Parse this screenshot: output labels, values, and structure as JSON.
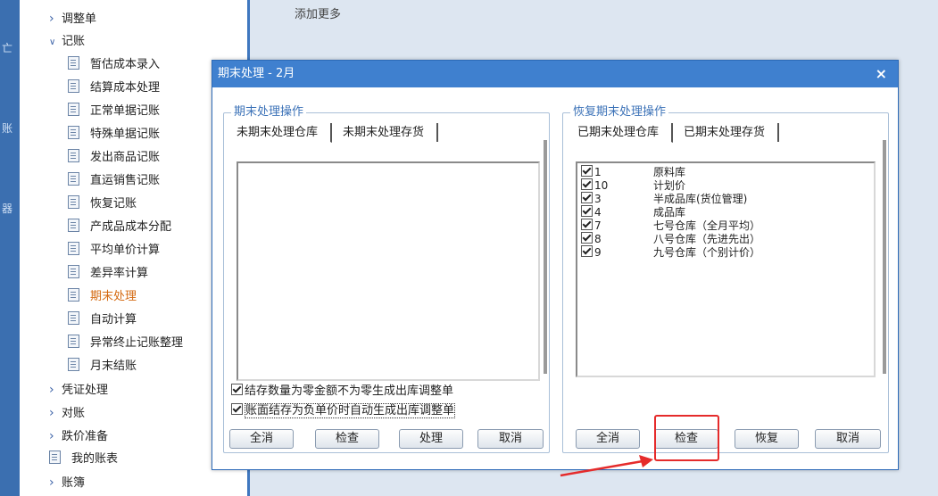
{
  "tree": {
    "partial_top": "",
    "items": [
      {
        "label": "调整单",
        "type": "folder",
        "state": "collapsed"
      },
      {
        "label": "记账",
        "type": "folder",
        "state": "expanded"
      },
      {
        "label": "暂估成本录入",
        "type": "doc"
      },
      {
        "label": "结算成本处理",
        "type": "doc"
      },
      {
        "label": "正常单据记账",
        "type": "doc"
      },
      {
        "label": "特殊单据记账",
        "type": "doc"
      },
      {
        "label": "发出商品记账",
        "type": "doc"
      },
      {
        "label": "直运销售记账",
        "type": "doc"
      },
      {
        "label": "恢复记账",
        "type": "doc"
      },
      {
        "label": "产成品成本分配",
        "type": "doc"
      },
      {
        "label": "平均单价计算",
        "type": "doc"
      },
      {
        "label": "差异率计算",
        "type": "doc"
      },
      {
        "label": "期末处理",
        "type": "doc",
        "active": true
      },
      {
        "label": "自动计算",
        "type": "doc"
      },
      {
        "label": "异常终止记账整理",
        "type": "doc"
      },
      {
        "label": "月末结账",
        "type": "doc"
      },
      {
        "label": "凭证处理",
        "type": "folder",
        "state": "collapsed"
      },
      {
        "label": "对账",
        "type": "folder",
        "state": "collapsed"
      },
      {
        "label": "跌价准备",
        "type": "folder",
        "state": "collapsed"
      },
      {
        "label": "我的账表",
        "type": "doc-top"
      },
      {
        "label": "账簿",
        "type": "folder",
        "state": "collapsed"
      }
    ]
  },
  "main": {
    "add_more": "添加更多"
  },
  "dialog": {
    "title": "期末处理 - 2月",
    "close": "×",
    "left_group": {
      "label": "期末处理操作",
      "tabs": [
        "未期末处理仓库",
        "未期末处理存货"
      ],
      "options": [
        {
          "label": "结存数量为零金额不为零生成出库调整单",
          "checked": true
        },
        {
          "label": "账面结存为负单价时自动生成出库调整单",
          "checked": true
        }
      ],
      "buttons": [
        "全消",
        "检查",
        "处理",
        "取消"
      ]
    },
    "right_group": {
      "label": "恢复期末处理操作",
      "tabs": [
        "已期末处理仓库",
        "已期末处理存货"
      ],
      "rows": [
        {
          "code": "1",
          "name": "原料库",
          "checked": true
        },
        {
          "code": "10",
          "name": "计划价",
          "checked": true
        },
        {
          "code": "3",
          "name": "半成品库(货位管理)",
          "checked": true
        },
        {
          "code": "4",
          "name": "成品库",
          "checked": true
        },
        {
          "code": "7",
          "name": "七号仓库（全月平均）",
          "checked": true
        },
        {
          "code": "8",
          "name": "八号仓库（先进先出）",
          "checked": true
        },
        {
          "code": "9",
          "name": "九号仓库（个别计价）",
          "checked": true
        }
      ],
      "buttons": [
        "全消",
        "检查",
        "恢复",
        "取消"
      ]
    }
  },
  "colors": {
    "accent": "#3f80cf",
    "highlight": "#e52b2b",
    "active_item": "#d46a12"
  }
}
